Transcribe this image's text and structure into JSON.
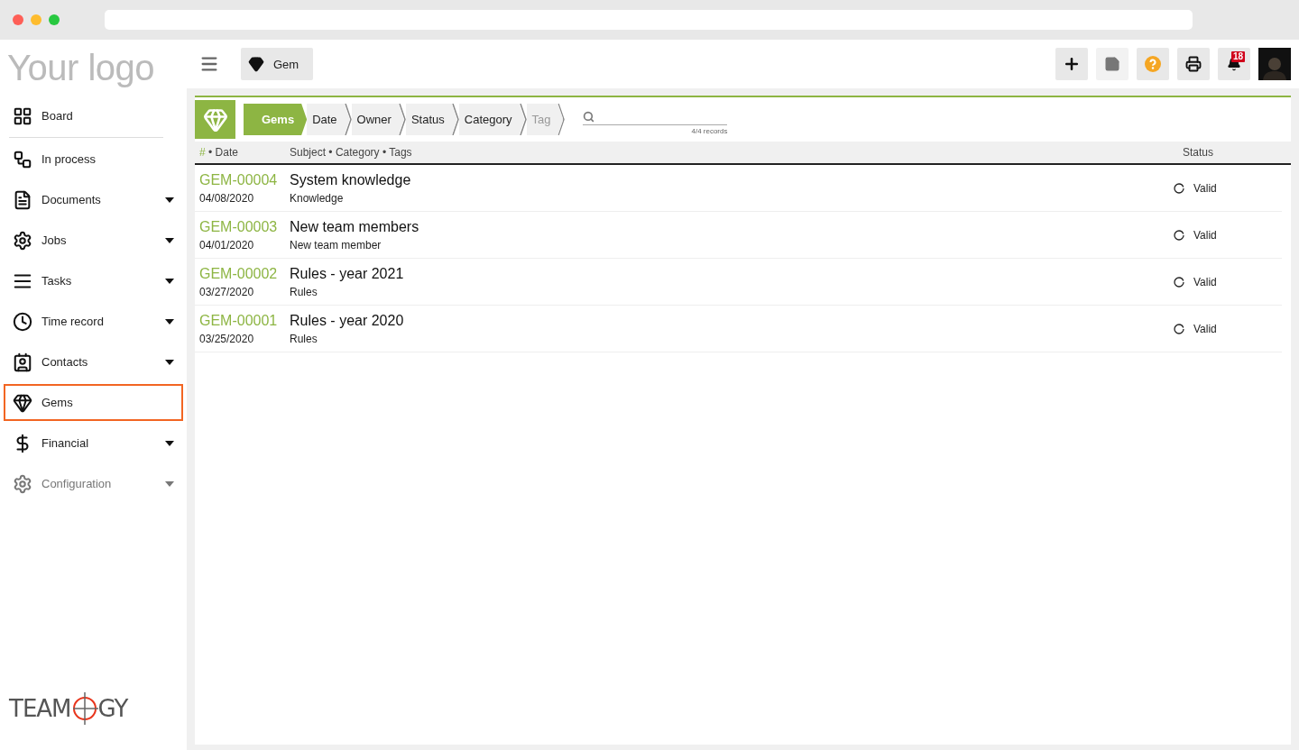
{
  "logo": {
    "text": "Your logo"
  },
  "module_button": {
    "label": "Gem"
  },
  "toolbar": [
    {
      "kind": "add"
    },
    {
      "kind": "note"
    },
    {
      "kind": "help"
    },
    {
      "kind": "print"
    },
    {
      "kind": "notifications",
      "badge": "18"
    }
  ],
  "sidebar": {
    "items": [
      {
        "kind": "board",
        "label": "Board",
        "caret": false,
        "selected": false,
        "disabled": false
      },
      {
        "kind": "process",
        "label": "In process",
        "caret": false,
        "selected": false,
        "disabled": false
      },
      {
        "kind": "documents",
        "label": "Documents",
        "caret": true,
        "selected": false,
        "disabled": false
      },
      {
        "kind": "jobs",
        "label": "Jobs",
        "caret": true,
        "selected": false,
        "disabled": false
      },
      {
        "kind": "tasks",
        "label": "Tasks",
        "caret": true,
        "selected": false,
        "disabled": false
      },
      {
        "kind": "time",
        "label": "Time record",
        "caret": true,
        "selected": false,
        "disabled": false
      },
      {
        "kind": "contacts",
        "label": "Contacts",
        "caret": true,
        "selected": false,
        "disabled": false
      },
      {
        "kind": "gems",
        "label": "Gems",
        "caret": false,
        "selected": true,
        "disabled": false
      },
      {
        "kind": "financial",
        "label": "Financial",
        "caret": true,
        "selected": false,
        "disabled": false
      },
      {
        "kind": "config",
        "label": "Configuration",
        "caret": true,
        "selected": false,
        "disabled": true
      }
    ]
  },
  "footer_logo": {
    "left": "TEAM",
    "right": "GY"
  },
  "breadcrumbs": [
    {
      "label": "Gems",
      "selected": true,
      "disabled": false
    },
    {
      "label": "Date",
      "selected": false,
      "disabled": false
    },
    {
      "label": "Owner",
      "selected": false,
      "disabled": false
    },
    {
      "label": "Status",
      "selected": false,
      "disabled": false
    },
    {
      "label": "Category",
      "selected": false,
      "disabled": false
    },
    {
      "label": "Tag",
      "selected": false,
      "disabled": true
    }
  ],
  "search": {
    "records": "4/4 records"
  },
  "table": {
    "columns": {
      "hash": "#",
      "date": "• Date",
      "subject": "Subject • Category • Tags",
      "status": "Status"
    },
    "rows": [
      {
        "id": "GEM-00004",
        "date": "04/08/2020",
        "subject": "System knowledge",
        "category": "Knowledge",
        "status": "Valid"
      },
      {
        "id": "GEM-00003",
        "date": "04/01/2020",
        "subject": "New team members",
        "category": "New team member",
        "status": "Valid"
      },
      {
        "id": "GEM-00002",
        "date": "03/27/2020",
        "subject": "Rules - year 2021",
        "category": "Rules",
        "status": "Valid"
      },
      {
        "id": "GEM-00001",
        "date": "03/25/2020",
        "subject": "Rules - year 2020",
        "category": "Rules",
        "status": "Valid"
      }
    ]
  }
}
